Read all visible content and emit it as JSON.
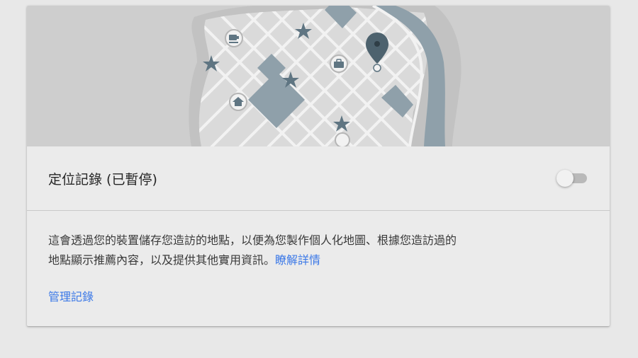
{
  "setting": {
    "title": "定位記錄 (已暫停)",
    "toggle_state": "off"
  },
  "description": {
    "line1": "這會透過您的裝置儲存您造訪的地點，以便為您製作個人化地圖、根據您造訪過的",
    "line2": "地點顯示推薦內容，以及提供其他實用資訊。",
    "learn_more": "瞭解詳情"
  },
  "manage_link": "管理記錄",
  "colors": {
    "page_bg": "#e8e8e8",
    "card_bg": "#ebebeb",
    "hero_bg": "#cecece",
    "link": "#3b78e7",
    "map_dark": "#8fa0aa",
    "map_light": "#dadada",
    "map_icon": "#5f7582"
  },
  "hero_icons": [
    "coffee-icon",
    "briefcase-icon",
    "home-icon",
    "star-icon",
    "map-pin-icon"
  ]
}
